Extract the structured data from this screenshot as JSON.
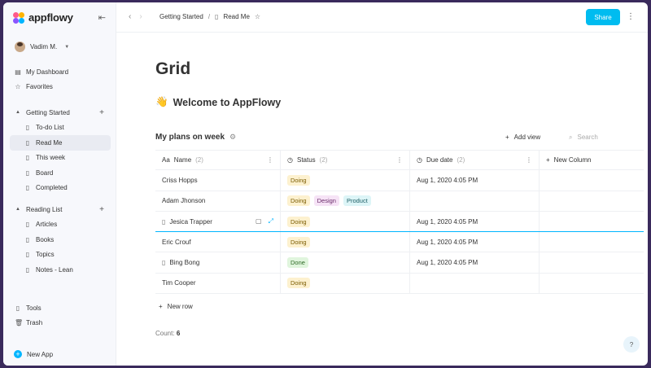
{
  "app": {
    "name": "appflowy"
  },
  "user": {
    "name": "Vadim M."
  },
  "sidebar": {
    "top_items": [
      {
        "label": "My Dashboard",
        "icon": "dashboard-icon"
      },
      {
        "label": "Favorites",
        "icon": "star-icon"
      }
    ],
    "section1": {
      "label": "Getting Started",
      "items": [
        "To-do List",
        "Read Me",
        "This week",
        "Board",
        "Completed"
      ],
      "active": "Read Me"
    },
    "section2": {
      "label": "Reading List",
      "items": [
        "Articles",
        "Books",
        "Topics",
        "Notes - Lean"
      ]
    },
    "bottom_items": [
      {
        "label": "Tools",
        "icon": "document-icon"
      },
      {
        "label": "Trash",
        "icon": "trash-icon"
      }
    ],
    "new_app": "New App"
  },
  "topbar": {
    "breadcrumb": [
      "Getting Started",
      "Read Me"
    ],
    "share": "Share"
  },
  "page": {
    "title": "Grid",
    "welcome_emoji": "👋",
    "welcome": "Welcome to AppFlowy"
  },
  "grid": {
    "title": "My plans on week",
    "add_view": "Add view",
    "search_placeholder": "Search",
    "columns": [
      {
        "prefix": "Aa",
        "label": "Name",
        "count": "(2)"
      },
      {
        "prefix": "◷",
        "label": "Status",
        "count": "(2)"
      },
      {
        "prefix": "◷",
        "label": "Due date",
        "count": "(2)"
      },
      {
        "prefix": "+",
        "label": "New Column",
        "count": ""
      }
    ],
    "rows": [
      {
        "name": "Criss Hopps",
        "tags": [
          {
            "t": "Doing",
            "bg": "#fdf1cf",
            "fg": "#7a5b00"
          }
        ],
        "due": "Aug 1, 2020 4:05 PM"
      },
      {
        "name": "Adam Jhonson",
        "tags": [
          {
            "t": "Doing",
            "bg": "#fdf1cf",
            "fg": "#7a5b00"
          },
          {
            "t": "Design",
            "bg": "#f6e3f6",
            "fg": "#6b2d6b"
          },
          {
            "t": "Product",
            "bg": "#ddf5f7",
            "fg": "#1f5f66"
          }
        ],
        "due": ""
      },
      {
        "name": "Jesica Trapper",
        "tags": [
          {
            "t": "Doing",
            "bg": "#fdf1cf",
            "fg": "#7a5b00"
          }
        ],
        "due": "Aug 1, 2020 4:05 PM"
      },
      {
        "name": "Eric Crouf",
        "tags": [
          {
            "t": "Doing",
            "bg": "#fdf1cf",
            "fg": "#7a5b00"
          }
        ],
        "due": "Aug 1, 2020 4:05 PM"
      },
      {
        "name": "Bing Bong",
        "tags": [
          {
            "t": "Done",
            "bg": "#e0f5dd",
            "fg": "#2f6b27"
          }
        ],
        "due": "Aug 1, 2020 4:05 PM"
      },
      {
        "name": "Tim Cooper",
        "tags": [
          {
            "t": "Doing",
            "bg": "#fdf1cf",
            "fg": "#7a5b00"
          }
        ],
        "due": ""
      }
    ],
    "new_row": "New row",
    "count_label": "Count:",
    "count_value": "6"
  },
  "help": "?"
}
